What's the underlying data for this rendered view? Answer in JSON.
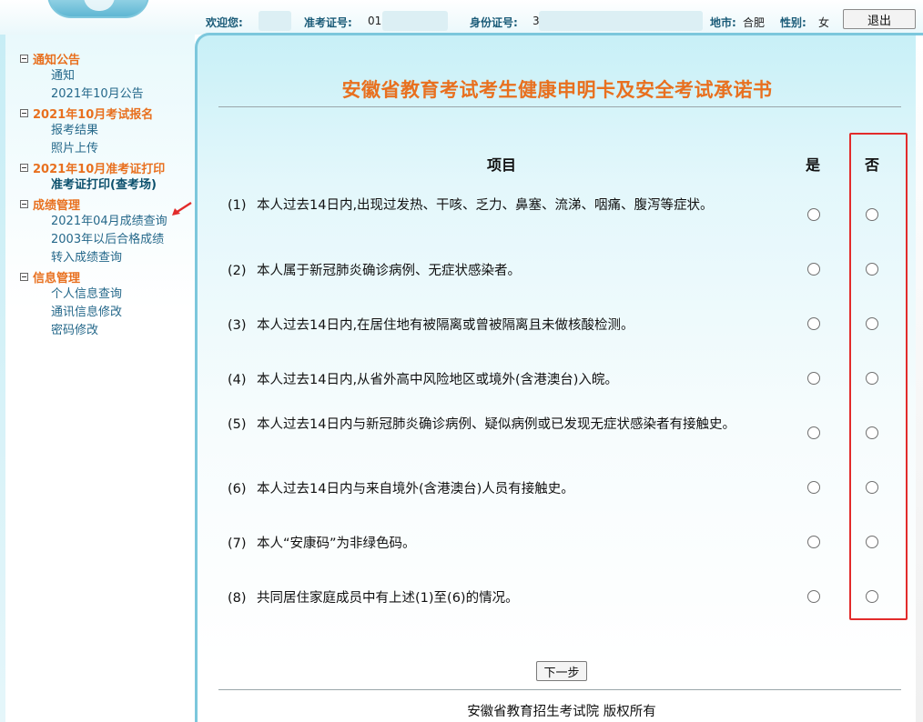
{
  "header": {
    "welcome_label": "欢迎您:",
    "ticket_label": "准考证号:",
    "ticket_value": "01",
    "idcard_label": "身份证号:",
    "idcard_value": "3",
    "city_label": "地市:",
    "city_value": "合肥",
    "gender_label": "性别:",
    "gender_value": "女",
    "logout_label": "退出"
  },
  "sidebar": {
    "groups": [
      {
        "title": "通知公告",
        "items": [
          "通知",
          "2021年10月公告"
        ]
      },
      {
        "title": "2021年10月考试报名",
        "items": [
          "报考结果",
          "照片上传"
        ]
      },
      {
        "title": "2021年10月准考证打印",
        "items": [
          "准考证打印(查考场)"
        ]
      },
      {
        "title": "成绩管理",
        "items": [
          "2021年04月成绩查询",
          "2003年以后合格成绩",
          "转入成绩查询"
        ]
      },
      {
        "title": "信息管理",
        "items": [
          "个人信息查询",
          "通讯信息修改",
          "密码修改"
        ]
      }
    ]
  },
  "main": {
    "title": "安徽省教育考试考生健康申明卡及安全考试承诺书",
    "col_item": "项目",
    "col_yes": "是",
    "col_no": "否",
    "questions": [
      {
        "num": "(1)",
        "text": "本人过去14日内,出现过发热、干咳、乏力、鼻塞、流涕、咽痛、腹泻等症状。"
      },
      {
        "num": "(2)",
        "text": "本人属于新冠肺炎确诊病例、无症状感染者。"
      },
      {
        "num": "(3)",
        "text": "本人过去14日内,在居住地有被隔离或曾被隔离且未做核酸检测。"
      },
      {
        "num": "(4)",
        "text": "本人过去14日内,从省外高中风险地区或境外(含港澳台)入皖。"
      },
      {
        "num": "(5)",
        "text": "本人过去14日内与新冠肺炎确诊病例、疑似病例或已发现无症状感染者有接触史。"
      },
      {
        "num": "(6)",
        "text": "本人过去14日内与来自境外(含港澳台)人员有接触史。"
      },
      {
        "num": "(7)",
        "text": "本人“安康码”为非绿色码。"
      },
      {
        "num": "(8)",
        "text": "共同居住家庭成员中有上述(1)至(6)的情况。"
      }
    ],
    "next_label": "下一步",
    "footer": "安徽省教育招生考试院 版权所有"
  },
  "colors": {
    "accent": "#e8701f",
    "link": "#25688a",
    "highlight": "#e22b2b",
    "border": "#7cc7dc"
  }
}
